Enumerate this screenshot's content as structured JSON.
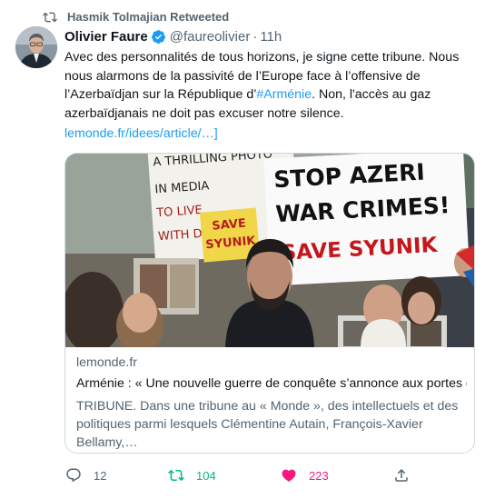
{
  "retweet_banner": {
    "text": "Hasmik Tolmajian Retweeted",
    "icon": "retweet-icon"
  },
  "author": {
    "name": "Olivier Faure",
    "handle": "@faureolivier",
    "separator": "·",
    "time": "11h",
    "verified": true
  },
  "tweet": {
    "text_part1": "Avec des personnalités de tous horizons, je signe cette tribune. Nous nous alarmons de la passivité de l’Europe face à l’offensive de l’Azerbaïdjan sur la République d’",
    "hashtag": "#Arménie",
    "text_part2": ". Non, l'accès au gaz azerbaïdjanais ne doit pas excuser notre silence.",
    "link": "lemonde.fr/idees/article/…]"
  },
  "card": {
    "image_signs": {
      "main_line1": "STOP AZERI",
      "main_line2": "WAR CRIMES!",
      "main_line3": "SAVE SYUNIK",
      "yellow_line1": "SAVE",
      "yellow_line2": "SYUNIK",
      "left_line1": "A THRILLING PHOTO",
      "left_line2": "IN MEDIA",
      "left_line3": "TO LIVE",
      "left_line4": "WITH D"
    },
    "domain": "lemonde.fr",
    "title": "Arménie : « Une nouvelle guerre de conquête s’annonce aux portes de…",
    "description": "TRIBUNE. Dans une tribune au « Monde », des intellectuels et des politiques parmi lesquels Clémentine Autain, François-Xavier Bellamy,…"
  },
  "actions": {
    "reply_count": "12",
    "retweet_count": "104",
    "like_count": "223",
    "colors": {
      "muted": "#536471",
      "retweet": "#00ba7c",
      "like": "#f91880",
      "link": "#1d9bf0"
    }
  }
}
